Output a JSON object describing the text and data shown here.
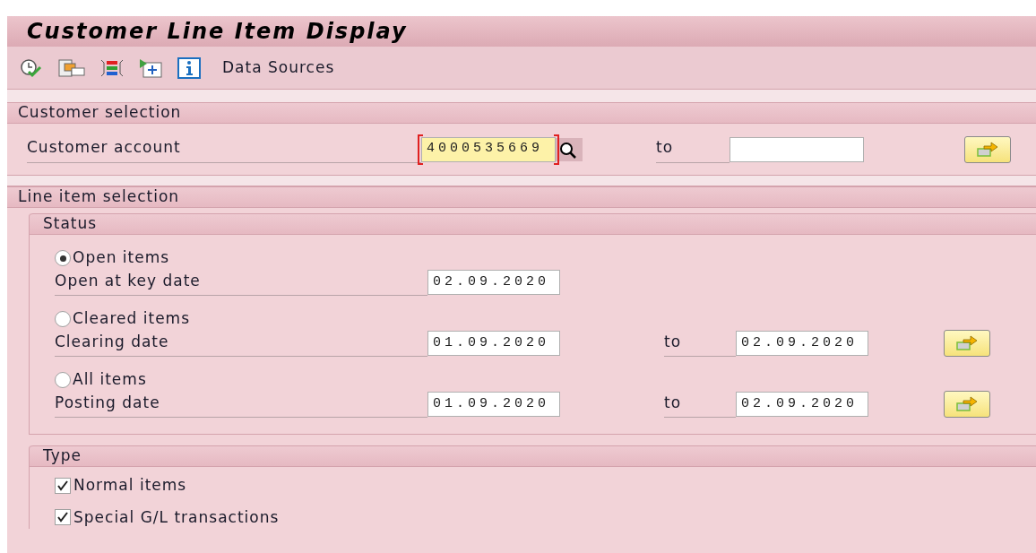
{
  "title": "Customer Line Item Display",
  "toolbar": {
    "label": "Data Sources"
  },
  "customer_selection": {
    "title": "Customer selection",
    "rows": [
      {
        "label": "Customer account",
        "from": "4000535669",
        "focused": true,
        "to_label": "to"
      }
    ]
  },
  "line_item_selection": {
    "title": "Line item selection",
    "status": {
      "title": "Status",
      "options": [
        {
          "label": "Open items",
          "selected": true,
          "date_label": "Open at key date",
          "from": "02.09.2020"
        },
        {
          "label": "Cleared items",
          "selected": false,
          "date_label": "Clearing date",
          "from": "01.09.2020",
          "to_label": "to",
          "to": "02.09.2020"
        },
        {
          "label": "All items",
          "selected": false,
          "date_label": "Posting date",
          "from": "01.09.2020",
          "to_label": "to",
          "to": "02.09.2020"
        }
      ]
    },
    "type": {
      "title": "Type",
      "items": [
        {
          "label": "Normal items",
          "checked": true
        },
        {
          "label": "Special G/L transactions",
          "checked": true
        }
      ]
    }
  }
}
